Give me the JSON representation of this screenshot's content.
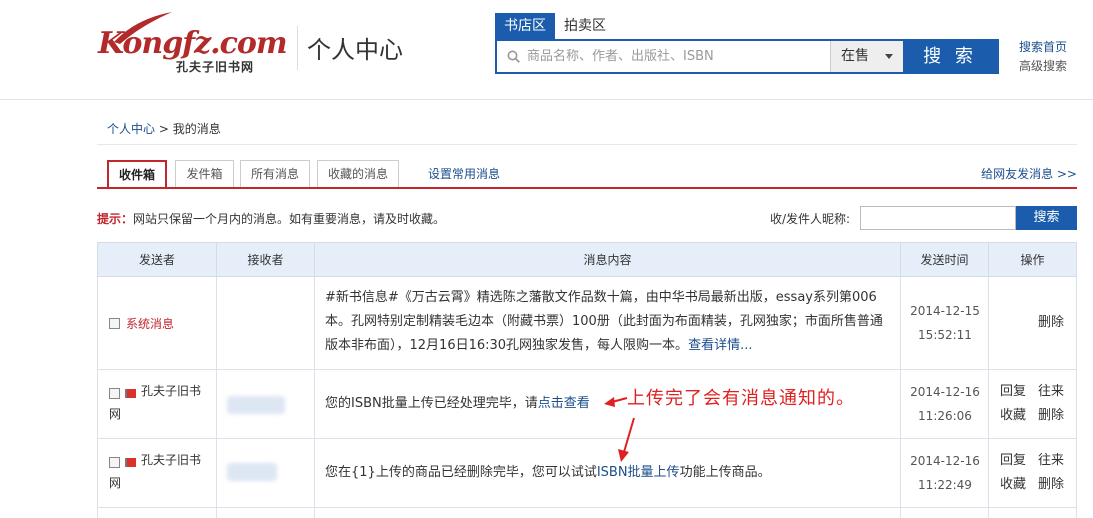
{
  "header": {
    "logo_text": "Kongfz.com",
    "logo_sub": "孔夫子旧书网",
    "site_title": "个人中心",
    "search": {
      "tab_active": "书店区",
      "tab_inactive": "拍卖区",
      "placeholder": "商品名称、作者、出版社、ISBN",
      "select_value": "在售",
      "button_label": "搜 索",
      "link_home": "搜索首页",
      "link_advanced": "高级搜索"
    }
  },
  "breadcrumb": {
    "root": "个人中心",
    "sep": " > ",
    "current": "我的消息"
  },
  "tabs": {
    "inbox": "收件箱",
    "outbox": "发件箱",
    "all": "所有消息",
    "favorites": "收藏的消息",
    "common": "设置常用消息",
    "compose": "给网友发消息 >>"
  },
  "tip": {
    "label": "提示：",
    "text": "网站只保留一个月内的消息。如有重要消息，请及时收藏。"
  },
  "filter": {
    "label": "收/发件人昵称:",
    "button": "搜索"
  },
  "table": {
    "headers": [
      "发送者",
      "接收者",
      "消息内容",
      "发送时间",
      "操作"
    ],
    "rows": [
      {
        "sender": "系统消息",
        "content": "#新书信息#《万古云霄》精选陈之藩散文作品数十篇，由中华书局最新出版，essay系列第006本。孔网特别定制精装毛边本（附藏书票）100册（此封面为布面精装，孔网独家；市面所售普通版本非布面），12月16日16:30孔网独家发售，每人限购一本。",
        "content_link": "查看详情...",
        "date": "2014-12-15",
        "time": "15:52:11",
        "op_delete": "删除"
      },
      {
        "sender": "孔夫子旧书网",
        "content": "您的ISBN批量上传已经处理完毕，请",
        "content_link": "点击查看",
        "date": "2014-12-16",
        "time": "11:26:06",
        "op_reply": "回复",
        "op_history": "往来",
        "op_fav": "收藏",
        "op_delete": "删除"
      },
      {
        "sender": "孔夫子旧书网",
        "content_pre": "您在{1}上传的商品已经删除完毕，您可以试试",
        "content_link": "ISBN批量上传",
        "content_post": "功能上传商品。",
        "date": "2014-12-16",
        "time": "11:22:49",
        "op_reply": "回复",
        "op_history": "往来",
        "op_fav": "收藏",
        "op_delete": "删除"
      }
    ]
  },
  "annotation": "上传完了会有消息通知的。",
  "colors": {
    "brand_red": "#c1272d",
    "brand_blue": "#1b5cac",
    "link_blue": "#1b4e8c"
  }
}
